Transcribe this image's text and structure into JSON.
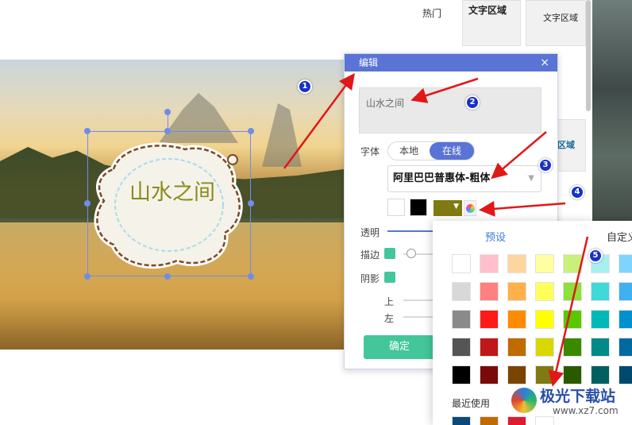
{
  "canvas": {
    "sticker_text": "山水之间"
  },
  "side_panel": {
    "tab_hot": "热门",
    "thumb_1_label": "文字区域",
    "thumb_2_label": "文字区域",
    "thumb_3_label": "区域"
  },
  "dialog": {
    "title": "编辑",
    "close": "×",
    "text_value": "山水之间",
    "font_label": "字体",
    "seg_local": "本地",
    "seg_online": "在线",
    "font_name": "阿里巴巴普惠体-粗体",
    "font_caret": "▼",
    "transparent_label": "透明",
    "stroke_label": "描边",
    "shadow_label": "阴影",
    "up_label": "上",
    "left_label": "左",
    "ok": "确定",
    "colors": {
      "selected_text_color": "#7f7a12",
      "white_swatch": "#ffffff",
      "black_swatch": "#000000",
      "accent": "#5a74d6",
      "check": "#43c79a"
    }
  },
  "picker": {
    "tab_preset": "预设",
    "tab_custom": "自定义",
    "recent_label": "最近使用",
    "palette": [
      [
        "#ffffff",
        "#ffc0cb",
        "#ffd59e",
        "#ffffa0",
        "#c8f07a",
        "#a8f0f0",
        "#7fd4ff"
      ],
      [
        "#d8d8d8",
        "#ff8080",
        "#ffb04a",
        "#ffff5a",
        "#8ee03a",
        "#40d8d8",
        "#3fb0f0"
      ],
      [
        "#8a8a8a",
        "#ff1a1a",
        "#ff8c00",
        "#ffff00",
        "#5ac800",
        "#00b8b8",
        "#0090d0"
      ],
      [
        "#555555",
        "#c01818",
        "#c06a00",
        "#d8d800",
        "#3a8a00",
        "#008a8a",
        "#006aa0"
      ],
      [
        "#000000",
        "#7a0a0a",
        "#7a4400",
        "#7f7a12",
        "#2a5a00",
        "#006060",
        "#004a70"
      ]
    ],
    "recent": [
      "#0a4a7a",
      "#c06a00",
      "#e01a30",
      "#ffffff"
    ]
  },
  "annotations": {
    "badges": [
      "1",
      "2",
      "3",
      "4",
      "5"
    ],
    "arrow_color": "#e01818"
  },
  "watermark": {
    "title": "极光下载站",
    "url": "www.xz7.com"
  }
}
